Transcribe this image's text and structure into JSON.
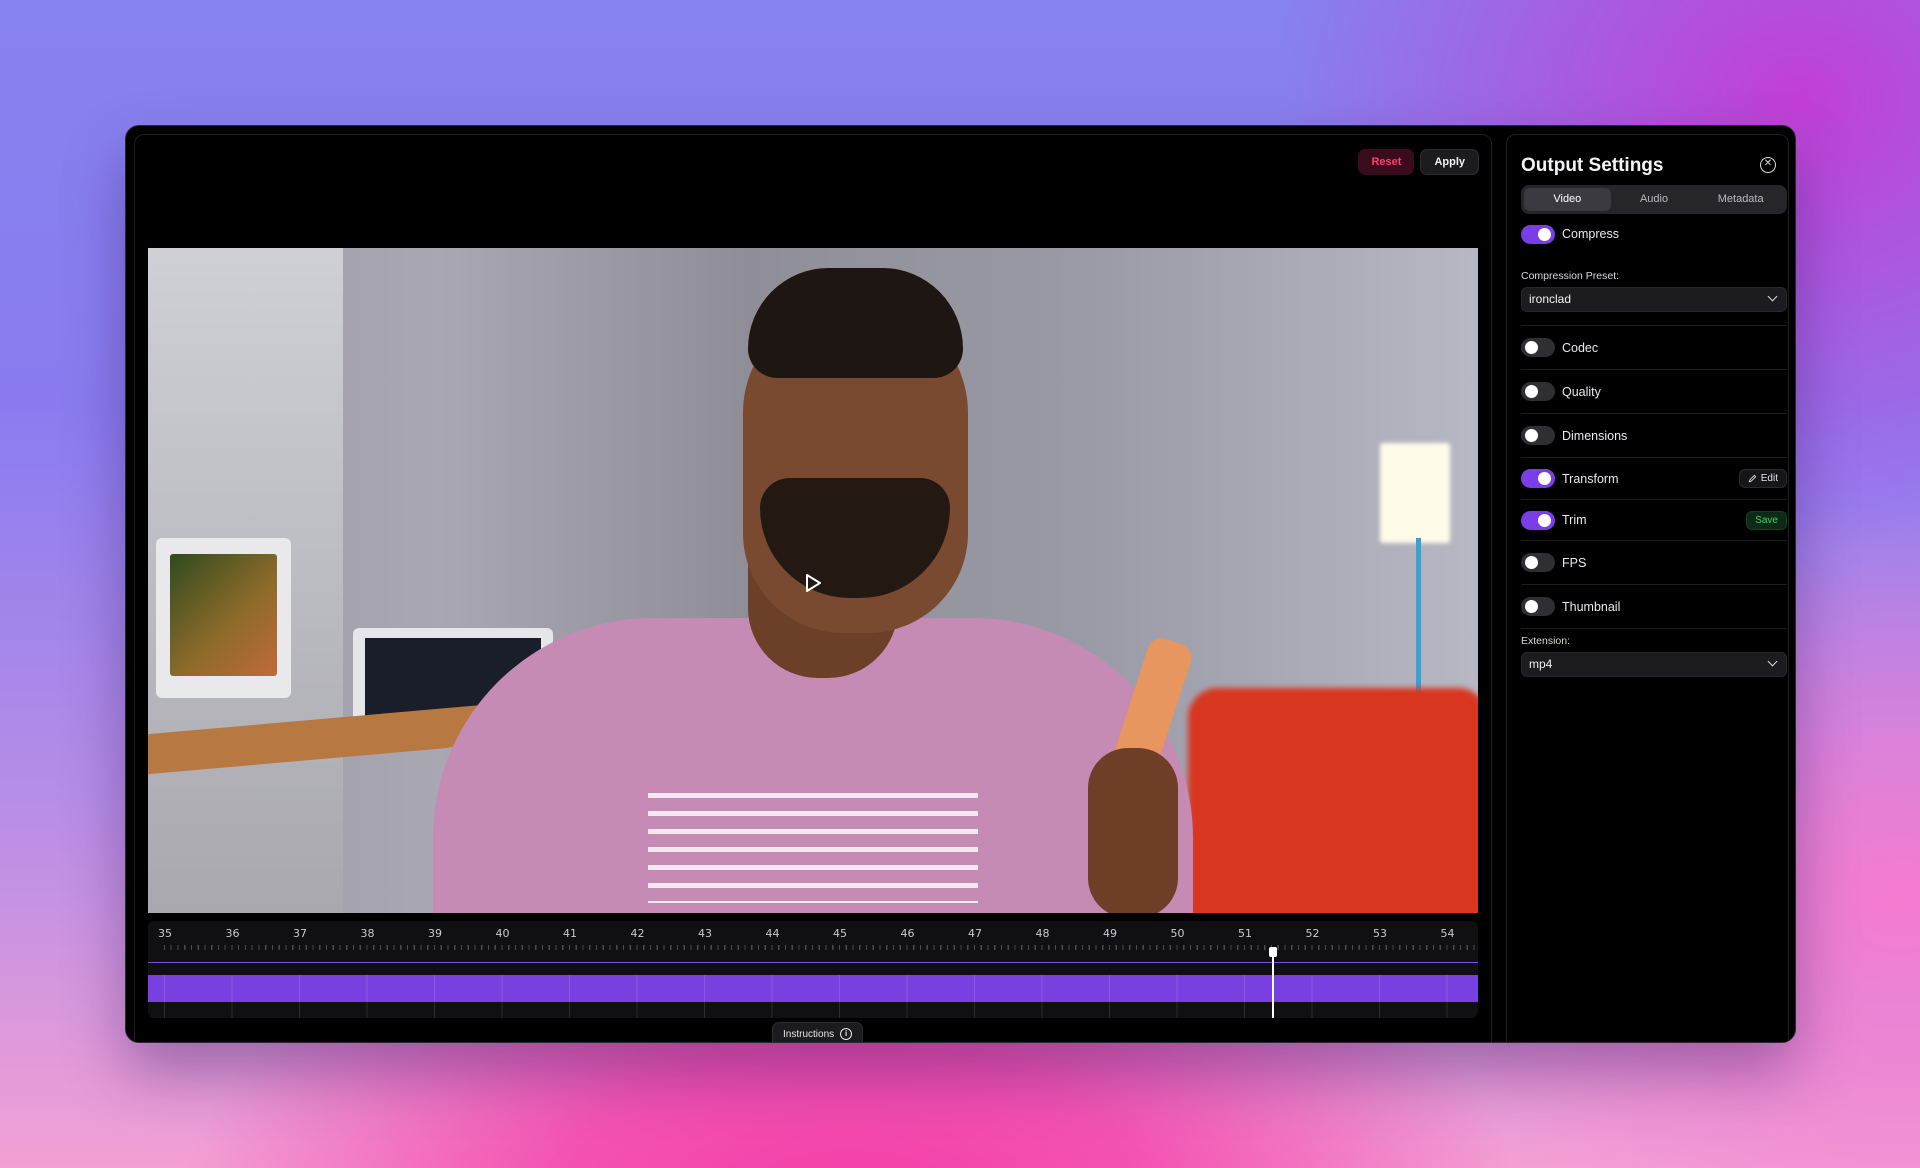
{
  "editor": {
    "reset_label": "Reset",
    "apply_label": "Apply",
    "instructions_label": "Instructions"
  },
  "timeline": {
    "tick_labels": [
      "35",
      "36",
      "37",
      "38",
      "39",
      "40",
      "41",
      "42",
      "43",
      "44",
      "45",
      "46",
      "47",
      "48",
      "49",
      "50",
      "51",
      "52",
      "53",
      "54"
    ],
    "playhead_position": 51.4
  },
  "panel": {
    "title": "Output Settings",
    "tabs": [
      {
        "label": "Video",
        "active": true
      },
      {
        "label": "Audio",
        "active": false
      },
      {
        "label": "Metadata",
        "active": false
      }
    ],
    "compress": {
      "label": "Compress",
      "enabled": true
    },
    "compression_preset": {
      "label": "Compression Preset:",
      "value": "ironclad"
    },
    "settings": [
      {
        "label": "Codec",
        "enabled": false
      },
      {
        "label": "Quality",
        "enabled": false
      },
      {
        "label": "Dimensions",
        "enabled": false
      },
      {
        "label": "Transform",
        "enabled": true,
        "action": "Edit"
      },
      {
        "label": "Trim",
        "enabled": true,
        "action": "Save"
      },
      {
        "label": "FPS",
        "enabled": false
      },
      {
        "label": "Thumbnail",
        "enabled": false
      }
    ],
    "extension": {
      "label": "Extension:",
      "value": "mp4"
    }
  },
  "colors": {
    "accent": "#7a3ee6",
    "reset": "#ff3f73",
    "save": "#37d066"
  }
}
